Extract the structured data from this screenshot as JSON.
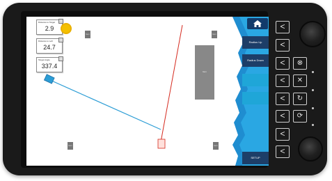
{
  "fields": [
    {
      "label": "Distance to Target",
      "value": "2.9"
    },
    {
      "label": "Distance to Left",
      "value": "24.7"
    },
    {
      "label": "Target Angle",
      "value": "337.4"
    }
  ],
  "map": {
    "boxes": [
      "Item",
      "Item",
      "Item",
      "Item",
      "Item"
    ],
    "big_block": "Item"
  },
  "sidebar": {
    "buttons": [
      "Radius Up",
      "Radius Down",
      "",
      "",
      "SETUP"
    ]
  },
  "controls": {
    "chevron": "<",
    "icons": [
      "⊗",
      "✕",
      "↻",
      "⟳"
    ]
  },
  "colors": {
    "accent": "#1fa6d8",
    "dark_accent": "#123b6b",
    "line_red": "#d52a1f",
    "line_blue": "#2c9dd5"
  }
}
